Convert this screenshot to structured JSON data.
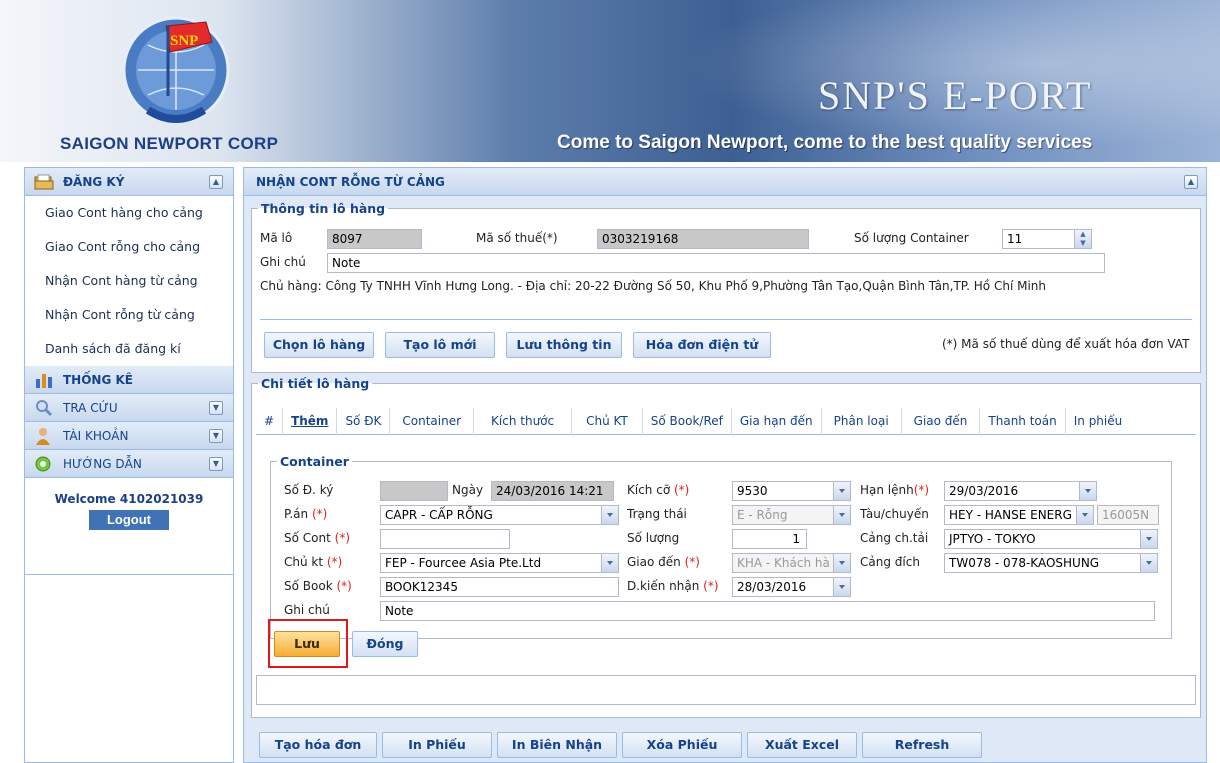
{
  "header": {
    "company": "SAIGON NEWPORT CORP",
    "brand": "SNP'S E-PORT",
    "slogan": "Come to Saigon Newport, come to the best quality services",
    "logo_text": "SNP"
  },
  "sidebar": {
    "sections": [
      {
        "label": "ĐĂNG KÝ",
        "icon": "folder-icon",
        "toggle": "collapse"
      },
      {
        "label": "THỐNG KÊ",
        "icon": "bar-chart-icon"
      },
      {
        "label": "TRA CỨU",
        "icon": "search-icon",
        "toggle": "expand"
      },
      {
        "label": "TÀI KHOẢN",
        "icon": "user-icon",
        "toggle": "expand"
      },
      {
        "label": "HƯỚNG DẪN",
        "icon": "help-icon",
        "toggle": "expand"
      }
    ],
    "items": [
      {
        "label": "Giao Cont hàng cho cảng"
      },
      {
        "label": "Giao Cont rỗng cho cảng"
      },
      {
        "label": "Nhận Cont hàng từ cảng"
      },
      {
        "label": "Nhận Cont rỗng từ cảng"
      },
      {
        "label": "Danh sách đã đăng kí"
      }
    ],
    "welcome": "Welcome 4102021039",
    "logout": "Logout"
  },
  "main": {
    "title": "NHẬN CONT RỖNG TỪ CẢNG",
    "lot_info": {
      "legend": "Thông tin lô hàng",
      "ma_lo_label": "Mã lô",
      "ma_lo_value": "8097",
      "tax_label": "Mã số thuế(*)",
      "tax_value": "0303219168",
      "count_label": "Số lượng Container",
      "count_value": "11",
      "note_label": "Ghi chú",
      "note_value": "Note",
      "owner": "Chủ hàng: Công Ty TNHH Vĩnh Hưng Long. - Địa chỉ: 20-22 Đường Số 50, Khu Phố 9,Phường Tân Tạo,Quận Bình Tân,TP. Hồ Chí Minh",
      "buttons": [
        "Chọn lô hàng",
        "Tạo lô mới",
        "Lưu thông tin",
        "Hóa đơn điện tử"
      ],
      "vat_note": "(*) Mã số thuế dùng để xuất hóa đơn VAT"
    },
    "detail": {
      "legend": "Chi tiết lô hàng",
      "tabs": [
        "#",
        "Thêm",
        "Số ĐK",
        "Container",
        "Kích thước",
        "Chủ KT",
        "Số Book/Ref",
        "Gia hạn đến",
        "Phân loại",
        "Giao đến",
        "Thanh toán",
        "In phiếu"
      ]
    },
    "container": {
      "legend": "Container",
      "so_dky_label": "Số Đ. ký",
      "so_dky_value": "",
      "ngay_label": "Ngày",
      "ngay_value": "24/03/2016 14:21",
      "kich_co_label": "Kích cỡ",
      "kich_co_value": "9530",
      "han_lenh_label": "Hạn lệnh",
      "han_lenh_value": "29/03/2016",
      "pan_label": "P.án",
      "pan_value": "CAPR - CẤP RỖNG",
      "trang_thai_label": "Trạng thái",
      "trang_thai_value": "E - Rỗng",
      "tau_label": "Tàu/chuyến",
      "tau_value": "HEY - HANSE ENERG",
      "tau_voyage": "16005N",
      "so_cont_label": "Số Cont",
      "so_cont_value": "",
      "so_luong_label": "Số lượng",
      "so_luong_value": "1",
      "cang_chtai_label": "Cảng ch.tải",
      "cang_chtai_value": "JPTYO - TOKYO",
      "chu_kt_label": "Chủ kt",
      "chu_kt_value": "FEP - Fourcee Asia Pte.Ltd",
      "giao_den_label": "Giao đến",
      "giao_den_value": "KHA - Khách hà",
      "cang_dich_label": "Cảng đích",
      "cang_dich_value": "TW078 - 078-KAOSHUNG",
      "so_book_label": "Số Book",
      "so_book_value": "BOOK12345",
      "dkien_label": "D.kiến nhận",
      "dkien_value": "28/03/2016",
      "ghi_chu_label": "Ghi chú",
      "ghi_chu_value": "Note",
      "req_mark": "(*)",
      "save": "Lưu",
      "close": "Đóng"
    },
    "footer_buttons": [
      "Tạo hóa đơn",
      "In Phiếu",
      "In Biên Nhận",
      "Xóa Phiếu",
      "Xuất Excel",
      "Refresh"
    ]
  },
  "colors": {
    "accent": "#15428b",
    "highlight": "#e0191b",
    "save_button": "#f6ad34"
  }
}
